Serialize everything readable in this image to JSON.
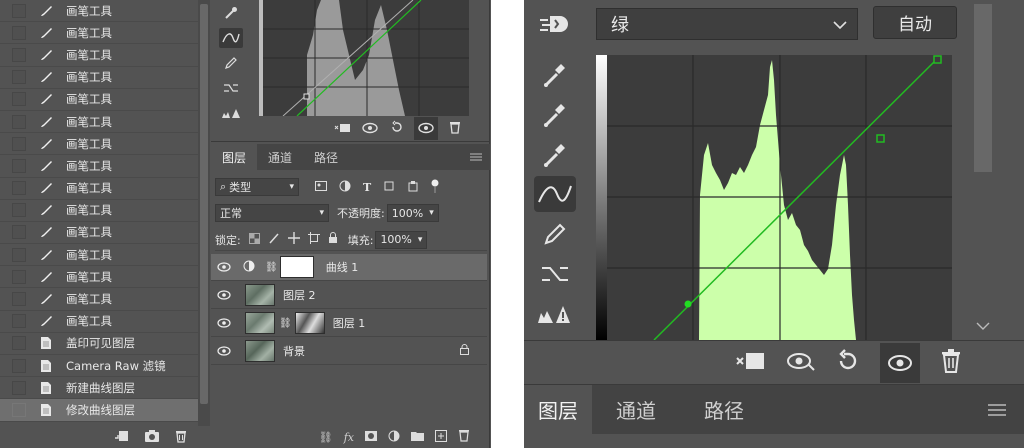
{
  "history": {
    "items": [
      {
        "label": "画笔工具",
        "icon": "brush-icon"
      },
      {
        "label": "画笔工具",
        "icon": "brush-icon"
      },
      {
        "label": "画笔工具",
        "icon": "brush-icon"
      },
      {
        "label": "画笔工具",
        "icon": "brush-icon"
      },
      {
        "label": "画笔工具",
        "icon": "brush-icon"
      },
      {
        "label": "画笔工具",
        "icon": "brush-icon"
      },
      {
        "label": "画笔工具",
        "icon": "brush-icon"
      },
      {
        "label": "画笔工具",
        "icon": "brush-icon"
      },
      {
        "label": "画笔工具",
        "icon": "brush-icon"
      },
      {
        "label": "画笔工具",
        "icon": "brush-icon"
      },
      {
        "label": "画笔工具",
        "icon": "brush-icon"
      },
      {
        "label": "画笔工具",
        "icon": "brush-icon"
      },
      {
        "label": "画笔工具",
        "icon": "brush-icon"
      },
      {
        "label": "画笔工具",
        "icon": "brush-icon"
      },
      {
        "label": "画笔工具",
        "icon": "brush-icon"
      },
      {
        "label": "盖印可见图层",
        "icon": "document-icon"
      },
      {
        "label": "Camera Raw 滤镜",
        "icon": "document-icon"
      },
      {
        "label": "新建曲线图层",
        "icon": "document-icon"
      },
      {
        "label": "修改曲线图层",
        "icon": "document-icon",
        "selected": true
      }
    ],
    "footer_icons": [
      "new-document-from-state-icon",
      "snapshot-camera-icon",
      "trash-icon"
    ]
  },
  "layers_panel": {
    "tabs": [
      "图层",
      "通道",
      "路径"
    ],
    "active_tab": "图层",
    "filter_kind": "类型",
    "blend_mode": "正常",
    "opacity_label": "不透明度:",
    "opacity_value": "100%",
    "lock_label": "锁定:",
    "fill_label": "填充:",
    "fill_value": "100%",
    "layers": [
      {
        "name": "曲线 1",
        "kind": "adjustment",
        "selected": true
      },
      {
        "name": "图层 2",
        "kind": "image"
      },
      {
        "name": "图层 1",
        "kind": "masked-image"
      },
      {
        "name": "背景",
        "kind": "background",
        "locked": true
      }
    ],
    "footer_icons": [
      "link-icon",
      "fx-icon",
      "add-mask-icon",
      "adjustment-icon",
      "folder-icon",
      "new-layer-icon",
      "trash-icon"
    ],
    "footer_fx_label": "fx"
  },
  "curves": {
    "channel": "绿",
    "auto_label": "自动",
    "tools": [
      "target-adjust-icon",
      "black-point-eyedropper-icon",
      "gray-point-eyedropper-icon",
      "white-point-eyedropper-icon",
      "curve-points-icon",
      "pencil-icon",
      "smooth-icon",
      "clipping-warning-icon"
    ],
    "tools_short": [
      "target-adjust-icon",
      "curve-points-icon",
      "pencil-icon",
      "smooth-icon",
      "clipping-warning-icon"
    ],
    "histogram_color": "#ccffaa",
    "curve_color": "#22bb22",
    "footer_icons": [
      "clip-to-layer-icon",
      "view-previous-icon",
      "reset-icon",
      "visibility-eye-icon",
      "trash-icon"
    ],
    "tabs": [
      "图层",
      "通道",
      "路径"
    ],
    "active_tab": "图层"
  }
}
